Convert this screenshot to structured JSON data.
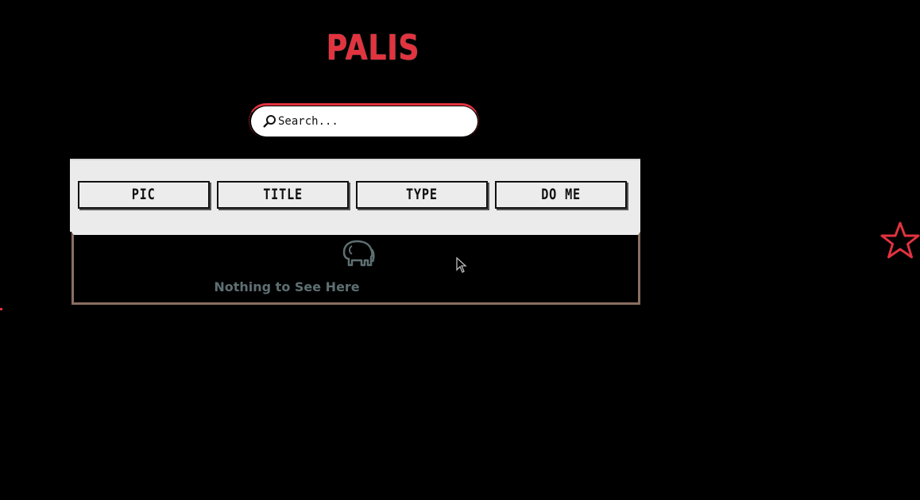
{
  "app": {
    "title": "PALIS"
  },
  "search": {
    "placeholder": "Search..."
  },
  "columns": [
    {
      "label": "PIC"
    },
    {
      "label": "TITLE"
    },
    {
      "label": "TYPE"
    },
    {
      "label": "DO ME"
    }
  ],
  "empty_state": {
    "message": "Nothing to See Here",
    "icon": "elephant-icon"
  },
  "decor": {
    "star_icon": "star-outline-icon",
    "accent_color": "#e2333f"
  }
}
